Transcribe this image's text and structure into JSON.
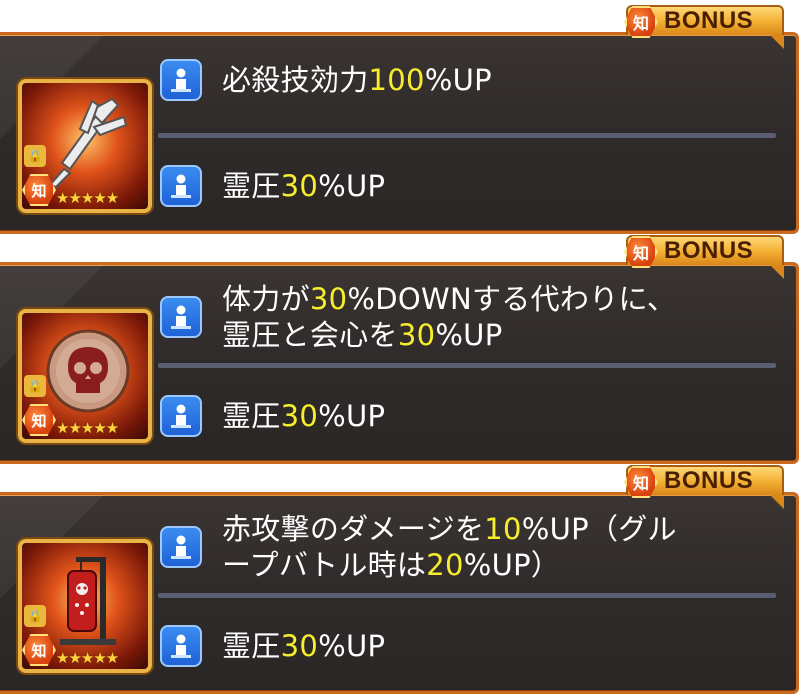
{
  "badge": {
    "kanji": "知",
    "label": "BONUS"
  },
  "colors": {
    "accent_border": "#c96a1e",
    "highlight": "#f6ee2c",
    "icon_blue": "#1f62d6"
  },
  "cards": [
    {
      "thumbnail": {
        "icon": "trident-icon",
        "lock": "🔒",
        "kanji": "知",
        "stars": "★★★★★",
        "rarity": 5
      },
      "effects": [
        {
          "pre": "必殺技効力",
          "value": "100",
          "post": "%UP"
        },
        {
          "pre": "霊圧",
          "value": "30",
          "post": "%UP"
        }
      ]
    },
    {
      "thumbnail": {
        "icon": "skull-icon",
        "lock": "🔒",
        "kanji": "知",
        "stars": "★★★★★",
        "rarity": 5
      },
      "effects": [
        {
          "line1_pre": "体力が",
          "line1_value": "30",
          "line1_post": "%DOWNする代わりに、",
          "line2_pre": "霊圧と会心を",
          "line2_value": "30",
          "line2_post": "%UP"
        },
        {
          "pre": "霊圧",
          "value": "30",
          "post": "%UP"
        }
      ]
    },
    {
      "thumbnail": {
        "icon": "punching-bag-icon",
        "lock": "🔒",
        "kanji": "知",
        "stars": "★★★★★",
        "rarity": 5
      },
      "effects": [
        {
          "line1_pre": "赤攻撃のダメージを",
          "line1_value": "10",
          "line1_post": "%UP（グル",
          "line2_pre": "ープバトル時は",
          "line2_value": "20",
          "line2_post": "%UP）"
        },
        {
          "pre": "霊圧",
          "value": "30",
          "post": "%UP"
        }
      ]
    }
  ]
}
